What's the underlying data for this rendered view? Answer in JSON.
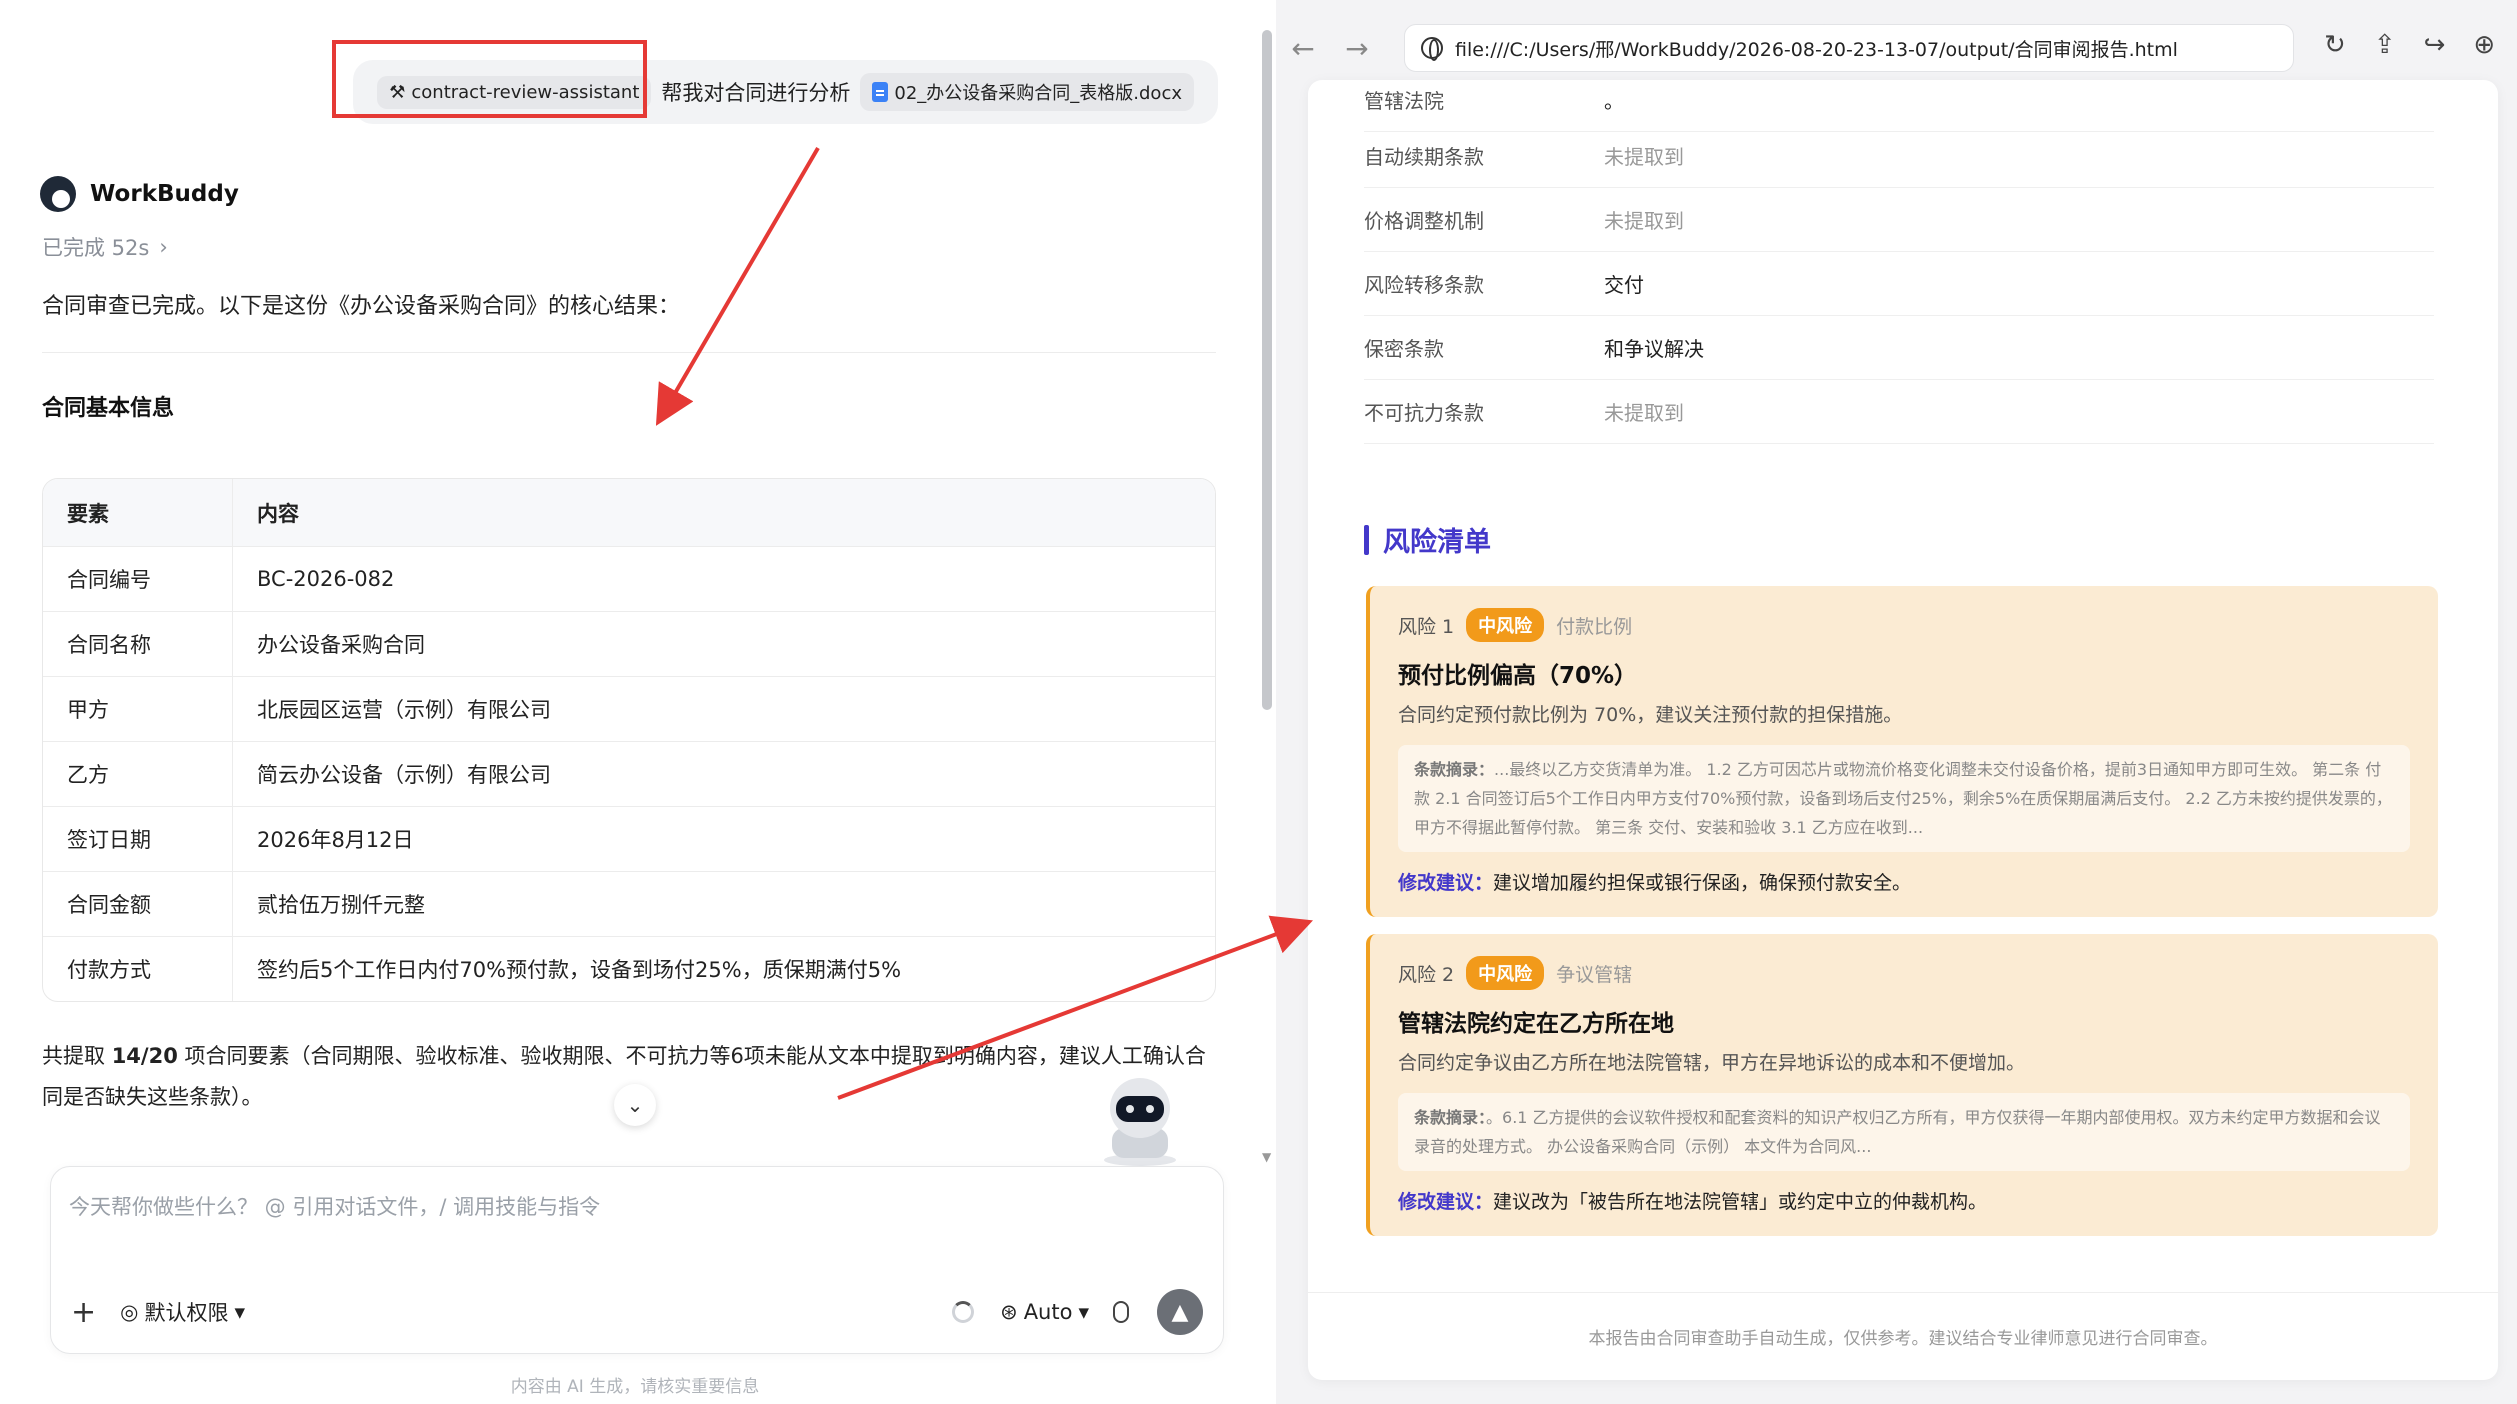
{
  "chat": {
    "user_message": {
      "skill": "contract-review-assistant",
      "text": "帮我对合同进行分析",
      "file": "02_办公设备采购合同_表格版.docx"
    },
    "bot_name": "WorkBuddy",
    "status": "已完成 52s",
    "intro": "合同审查已完成。以下是这份《办公设备采购合同》的核心结果：",
    "section_title": "合同基本信息",
    "table": {
      "headers": [
        "要素",
        "内容"
      ],
      "rows": [
        [
          "合同编号",
          "BC-2026-082"
        ],
        [
          "合同名称",
          "办公设备采购合同"
        ],
        [
          "甲方",
          "北辰园区运营（示例）有限公司"
        ],
        [
          "乙方",
          "简云办公设备（示例）有限公司"
        ],
        [
          "签订日期",
          "2026年8月12日"
        ],
        [
          "合同金额",
          "贰拾伍万捌仟元整"
        ],
        [
          "付款方式",
          "签约后5个工作日内付70%预付款，设备到场付25%，质保期满付5%"
        ]
      ]
    },
    "summary_prefix": "共提取 ",
    "summary_count": "14/20",
    "summary_rest": " 项合同要素（合同期限、验收标准、验收期限、不可抗力等6项未能从文本中提取到明确内容，建议人工确认合同是否缺失这些条款）。",
    "input_placeholder": "今天帮你做些什么？ @ 引用对话文件，/ 调用技能与指令",
    "permission": "默认权限",
    "model": "Auto",
    "footer_note": "内容由 AI 生成，请核实重要信息"
  },
  "browser": {
    "url": "file:///C:/Users/邢/WorkBuddy/2026-08-20-23-13-07/output/合同审阅报告.html",
    "partial_row": {
      "k": "管辖法院",
      "v": "。"
    },
    "rows": [
      {
        "k": "自动续期条款",
        "v": "未提取到"
      },
      {
        "k": "价格调整机制",
        "v": "未提取到"
      },
      {
        "k": "风险转移条款",
        "v": "交付"
      },
      {
        "k": "保密条款",
        "v": "和争议解决"
      },
      {
        "k": "不可抗力条款",
        "v": "未提取到"
      }
    ],
    "risk_heading": "风险清单",
    "risks": [
      {
        "label": "风险 1",
        "level": "中风险",
        "category": "付款比例",
        "title": "预付比例偏高（70%）",
        "desc": "合同约定预付款比例为 70%，建议关注预付款的担保措施。",
        "clause_label": "条款摘录：",
        "clause": "...最终以乙方交货清单为准。 1.2 乙方可因芯片或物流价格变化调整未交付设备价格，提前3日通知甲方即可生效。 第二条 付款 2.1 合同签订后5个工作日内甲方支付70%预付款，设备到场后支付25%，剩余5%在质保期届满后支付。 2.2 乙方未按约提供发票的，甲方不得据此暂停付款。 第三条 交付、安装和验收 3.1 乙方应在收到...",
        "suggest_label": "修改建议：",
        "suggest": "建议增加履约担保或银行保函，确保预付款安全。"
      },
      {
        "label": "风险 2",
        "level": "中风险",
        "category": "争议管辖",
        "title": "管辖法院约定在乙方所在地",
        "desc": "合同约定争议由乙方所在地法院管辖，甲方在异地诉讼的成本和不便增加。",
        "clause_label": "条款摘录：",
        "clause": "。6.1 乙方提供的会议软件授权和配套资料的知识产权归乙方所有，甲方仅获得一年期内部使用权。双方未约定甲方数据和会议录音的处理方式。 办公设备采购合同（示例） 本文件为合同风...",
        "suggest_label": "修改建议：",
        "suggest": "建议改为「被告所在地法院管辖」或约定中立的仲裁机构。"
      }
    ],
    "report_footer": "本报告由合同审查助手自动生成，仅供参考。建议结合专业律师意见进行合同审查。"
  },
  "colors": {
    "accent": "#4338ca",
    "risk_badge": "#f29a1a",
    "risk_card": "#fbebd3",
    "annotation_red": "#e53935"
  }
}
